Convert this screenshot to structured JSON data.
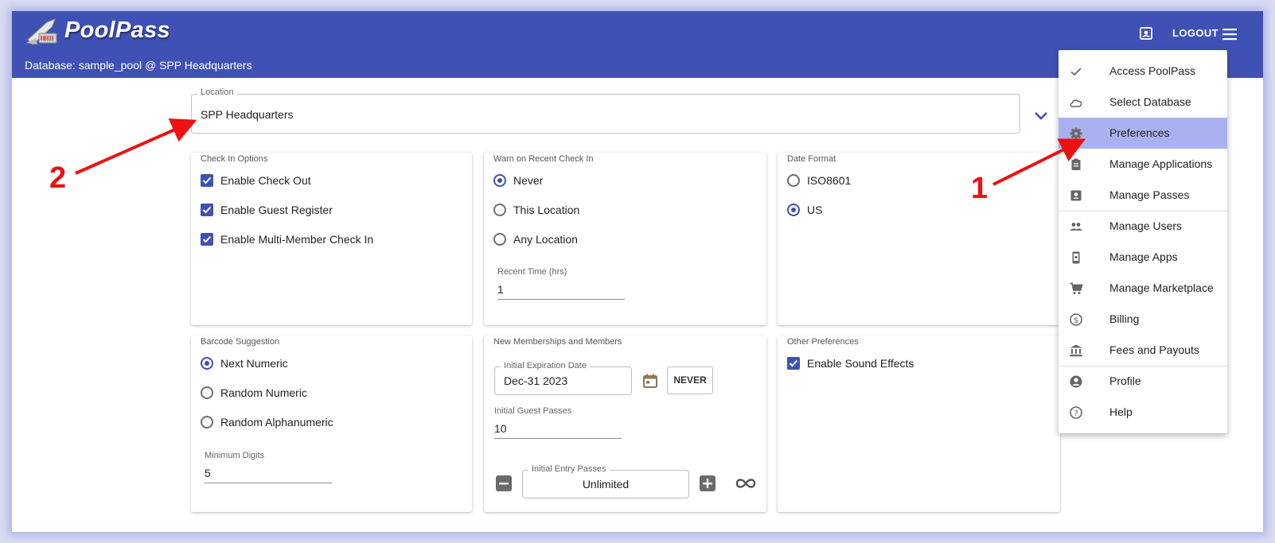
{
  "app": {
    "brand": "PoolPass",
    "database_line": "Database: sample_pool @ SPP Headquarters",
    "logout_label": "LOGOUT"
  },
  "location": {
    "label": "Location",
    "value": "SPP Headquarters"
  },
  "cards": {
    "check_in": {
      "title": "Check In Options",
      "options": [
        {
          "label": "Enable Check Out",
          "checked": true
        },
        {
          "label": "Enable Guest Register",
          "checked": true
        },
        {
          "label": "Enable Multi-Member Check In",
          "checked": true
        }
      ]
    },
    "warn": {
      "title": "Warn on Recent Check In",
      "options": [
        {
          "label": "Never",
          "selected": true
        },
        {
          "label": "This Location",
          "selected": false
        },
        {
          "label": "Any Location",
          "selected": false
        }
      ],
      "recent_time_label": "Recent Time (hrs)",
      "recent_time_value": "1"
    },
    "date_format": {
      "title": "Date Format",
      "options": [
        {
          "label": "ISO8601",
          "selected": false
        },
        {
          "label": "US",
          "selected": true
        }
      ]
    },
    "barcode": {
      "title": "Barcode Suggestion",
      "options": [
        {
          "label": "Next Numeric",
          "selected": true
        },
        {
          "label": "Random Numeric",
          "selected": false
        },
        {
          "label": "Random Alphanumeric",
          "selected": false
        }
      ],
      "min_digits_label": "Minimum Digits",
      "min_digits_value": "5"
    },
    "new_members": {
      "title": "New Memberships and Members",
      "expiration_label": "Initial Expiration Date",
      "expiration_value": "Dec-31 2023",
      "never_label": "NEVER",
      "guest_passes_label": "Initial Guest Passes",
      "guest_passes_value": "10",
      "entry_passes_label": "Initial Entry Passes",
      "entry_passes_value": "Unlimited"
    },
    "other": {
      "title": "Other Preferences",
      "options": [
        {
          "label": "Enable Sound Effects",
          "checked": true
        }
      ]
    }
  },
  "menu": {
    "items": [
      {
        "label": "Access PoolPass",
        "icon": "check-icon"
      },
      {
        "label": "Select Database",
        "icon": "cloud-icon"
      },
      {
        "label": "Preferences",
        "icon": "gear-icon",
        "active": true
      },
      {
        "label": "Manage Applications",
        "icon": "clipboard-icon"
      },
      {
        "label": "Manage Passes",
        "icon": "badge-icon"
      },
      {
        "label": "Manage Users",
        "icon": "people-icon"
      },
      {
        "label": "Manage Apps",
        "icon": "phone-icon"
      },
      {
        "label": "Manage Marketplace",
        "icon": "cart-icon"
      },
      {
        "label": "Billing",
        "icon": "dollar-icon"
      },
      {
        "label": "Fees and Payouts",
        "icon": "bank-icon"
      },
      {
        "label": "Profile",
        "icon": "account-icon"
      },
      {
        "label": "Help",
        "icon": "help-icon"
      }
    ]
  },
  "annotations": {
    "one": "1",
    "two": "2"
  },
  "colors": {
    "primary": "#3f51b5",
    "menu_highlight": "#aab1f0",
    "annotation": "#ee1111"
  }
}
